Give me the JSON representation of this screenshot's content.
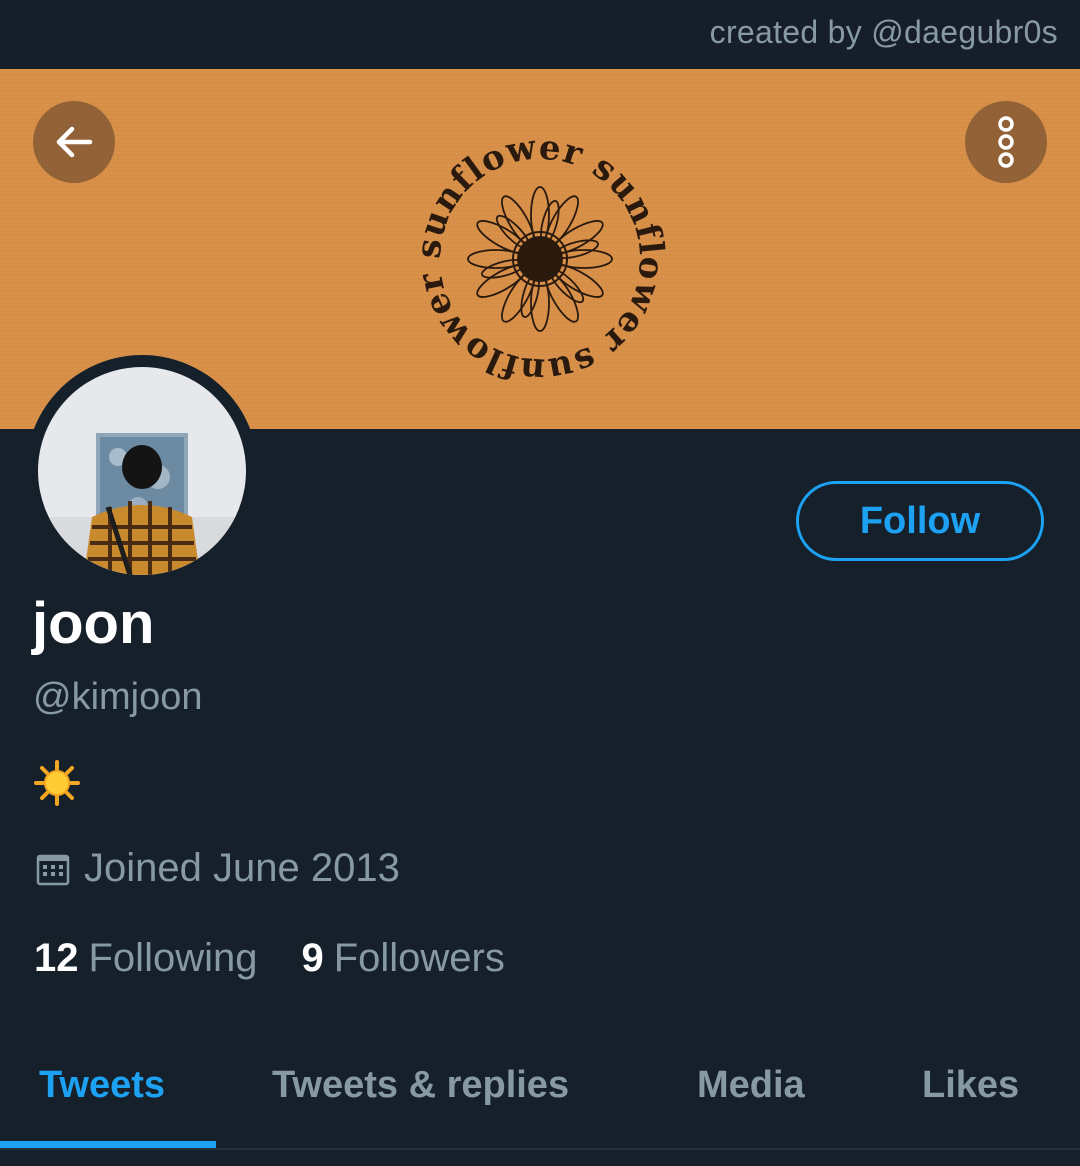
{
  "credit": "created by @daegubr0s",
  "banner": {
    "logo_text": "sunflower sunflower sunflower",
    "background_color": "#d99049"
  },
  "header_buttons": {
    "back_icon": "arrow-left-icon",
    "more_icon": "more-vertical-icon"
  },
  "profile": {
    "name": "joon",
    "handle": "@kimjoon",
    "bio_emoji": "sun-emoji",
    "joined": "Joined June 2013",
    "joined_icon": "calendar-icon",
    "following_count": "12",
    "following_label": "Following",
    "followers_count": "9",
    "followers_label": "Followers"
  },
  "follow_button": {
    "label": "Follow"
  },
  "tabs": [
    {
      "label": "Tweets",
      "active": true
    },
    {
      "label": "Tweets & replies",
      "active": false
    },
    {
      "label": "Media",
      "active": false
    },
    {
      "label": "Likes",
      "active": false
    }
  ],
  "colors": {
    "background": "#15202b",
    "accent": "#1da1f2",
    "secondary_text": "#8899a6",
    "banner": "#d99049"
  }
}
